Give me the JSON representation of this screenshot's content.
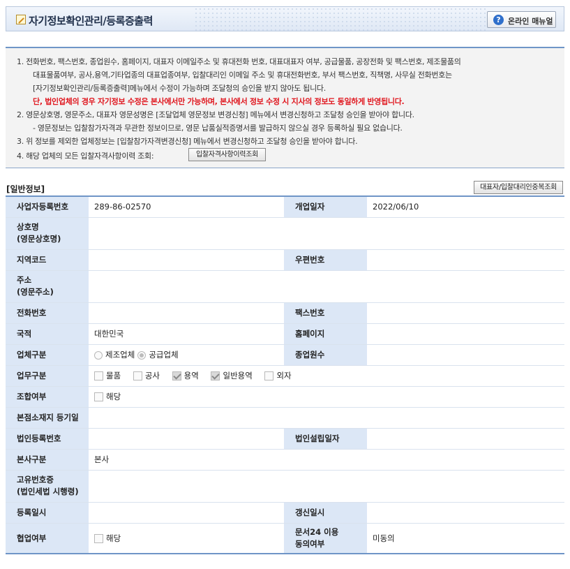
{
  "header": {
    "title": "자기정보확인관리/등록증출력",
    "manual_button": "온라인 매뉴얼"
  },
  "notice": {
    "line1": "1. 전화번호, 팩스번호, 종업원수, 홈페이지, 대표자 이메일주소 및 휴대전화 번호, 대표대표자 여부, 공급물품, 공장전화 및 팩스번호, 제조물품의",
    "line2": "대표물품여부, 공사,용역,기타업종의 대표업종여부, 입찰대리인 이메일 주소 및 휴대전화번호, 부서 팩스번호, 직책명, 사무실 전화번호는",
    "line3": "[자기정보확인관리/등록증출력]메뉴에서 수정이 가능하며 조달청의 승인을 받지 않아도 됩니다.",
    "line4_red": "단, 법인업체의 경우 자기정보 수정은 본사에서만 가능하며, 본사에서 정보 수정 시 지사의 정보도 동일하게 반영됩니다.",
    "line5": "2. 영문상호명, 영문주소, 대표자 영문성명은 [조달업체 영문정보 변경신청] 메뉴에서 변경신청하고 조달청 승인을 받아야 합니다.",
    "line6": "- 영문정보는 입찰참가자격과 무관한 정보이므로, 영문 납품실적증명서를 발급하지 않으실 경우 등록하실 필요 없습니다.",
    "line7": "3. 위 정보를 제외한 업체정보는 [입찰참가자격변경신청] 메뉴에서 변경신청하고 조달청 승인을 받아야 합니다.",
    "line8": "4. 해당 업체의 모든 입찰자격사항이력 조회:",
    "history_button": "입찰자격사항이력조회"
  },
  "section": {
    "title": "[일반정보]",
    "dup_button": "대표자/입찰대리인중복조회"
  },
  "fields": {
    "biz_no_label": "사업자등록번호",
    "biz_no": "289-86-02570",
    "open_date_label": "개업일자",
    "open_date": "2022/06/10",
    "company_label_1": "상호명",
    "company_label_2": "(영문상호명)",
    "region_label": "지역코드",
    "zip_label": "우편번호",
    "addr_label_1": "주소",
    "addr_label_2": "(영문주소)",
    "phone_label": "전화번호",
    "fax_label": "팩스번호",
    "country_label": "국적",
    "country": "대한민국",
    "homepage_label": "홈페이지",
    "biz_type_label": "업체구분",
    "biz_type_options": [
      "제조업체",
      "공급업체"
    ],
    "employees_label": "종업원수",
    "work_type_label": "업무구분",
    "work_type_options": [
      "물품",
      "공사",
      "용역",
      "일반용역",
      "외자"
    ],
    "union_label": "조합여부",
    "union_option": "해당",
    "hq_reg_label": "본점소재지 등기일",
    "corp_reg_label": "법인등록번호",
    "corp_est_label": "법인설립일자",
    "hq_type_label": "본사구분",
    "hq_type": "본사",
    "unique_label_1": "고유번호증",
    "unique_label_2": "(법인세법 시행령)",
    "reg_date_label": "등록일시",
    "renew_date_label": "갱신일시",
    "coop_label": "협업여부",
    "coop_option": "해당",
    "doc24_label_1": "문서24 이용",
    "doc24_label_2": "동의여부",
    "doc24_value": "미동의"
  }
}
